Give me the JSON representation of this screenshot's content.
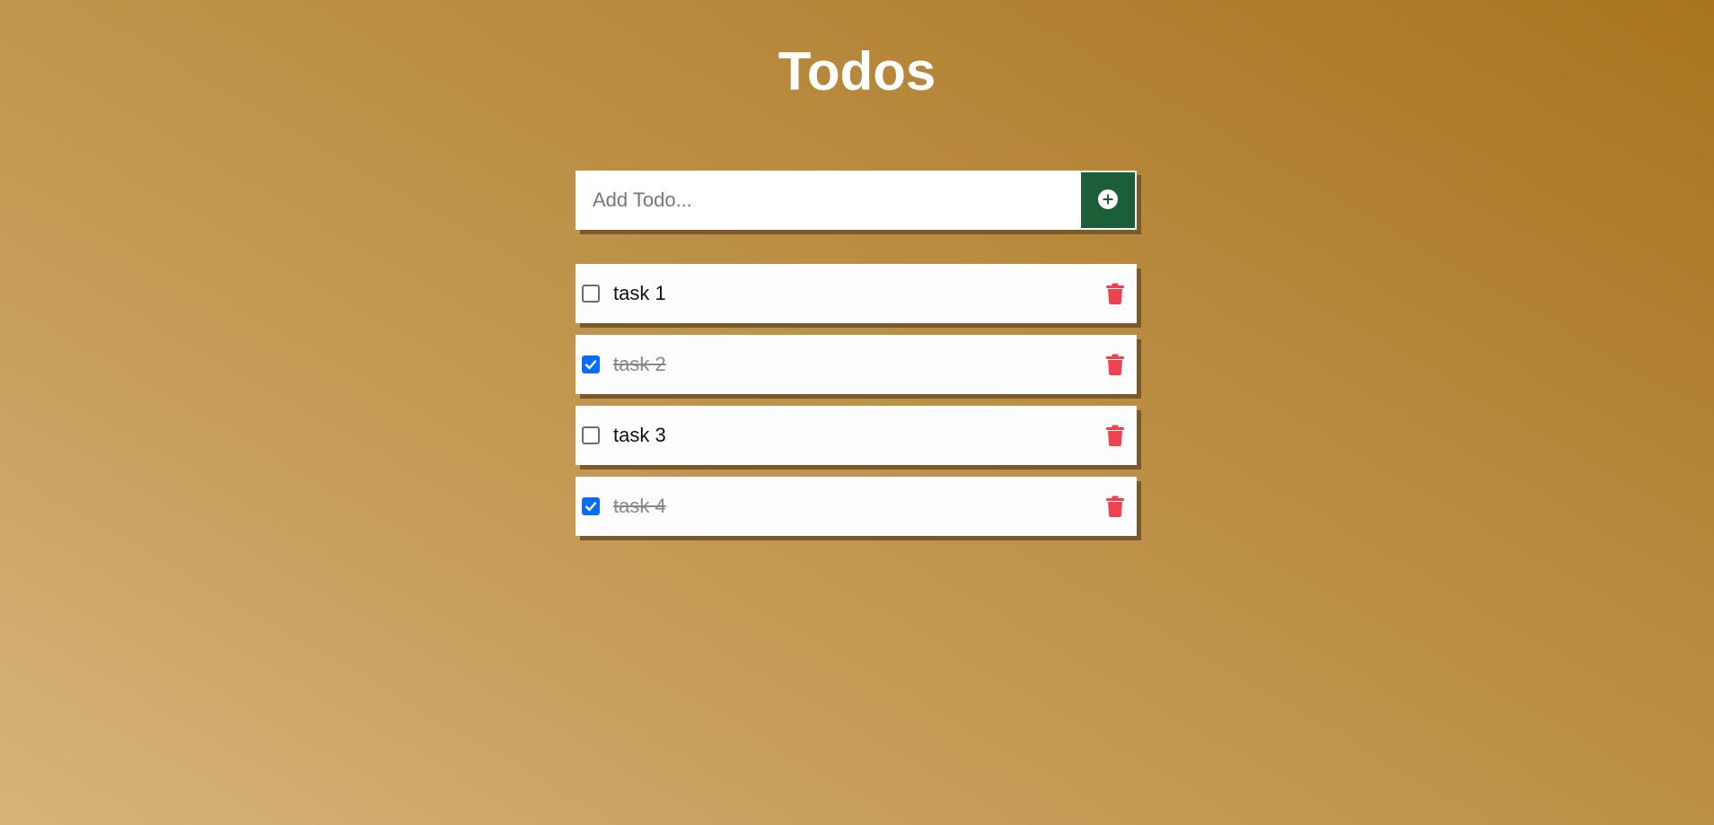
{
  "page": {
    "title": "Todos"
  },
  "form": {
    "placeholder": "Add Todo...",
    "value": "",
    "add_icon": "plus-circle-icon"
  },
  "todos": [
    {
      "text": "task 1",
      "completed": false
    },
    {
      "text": "task 2",
      "completed": true
    },
    {
      "text": "task 3",
      "completed": false
    },
    {
      "text": "task 4",
      "completed": true
    }
  ],
  "colors": {
    "add_button": "#1b5e38",
    "delete_icon": "#f0414f",
    "checkbox_checked": "#0a6cf2",
    "title": "#ffffff"
  }
}
